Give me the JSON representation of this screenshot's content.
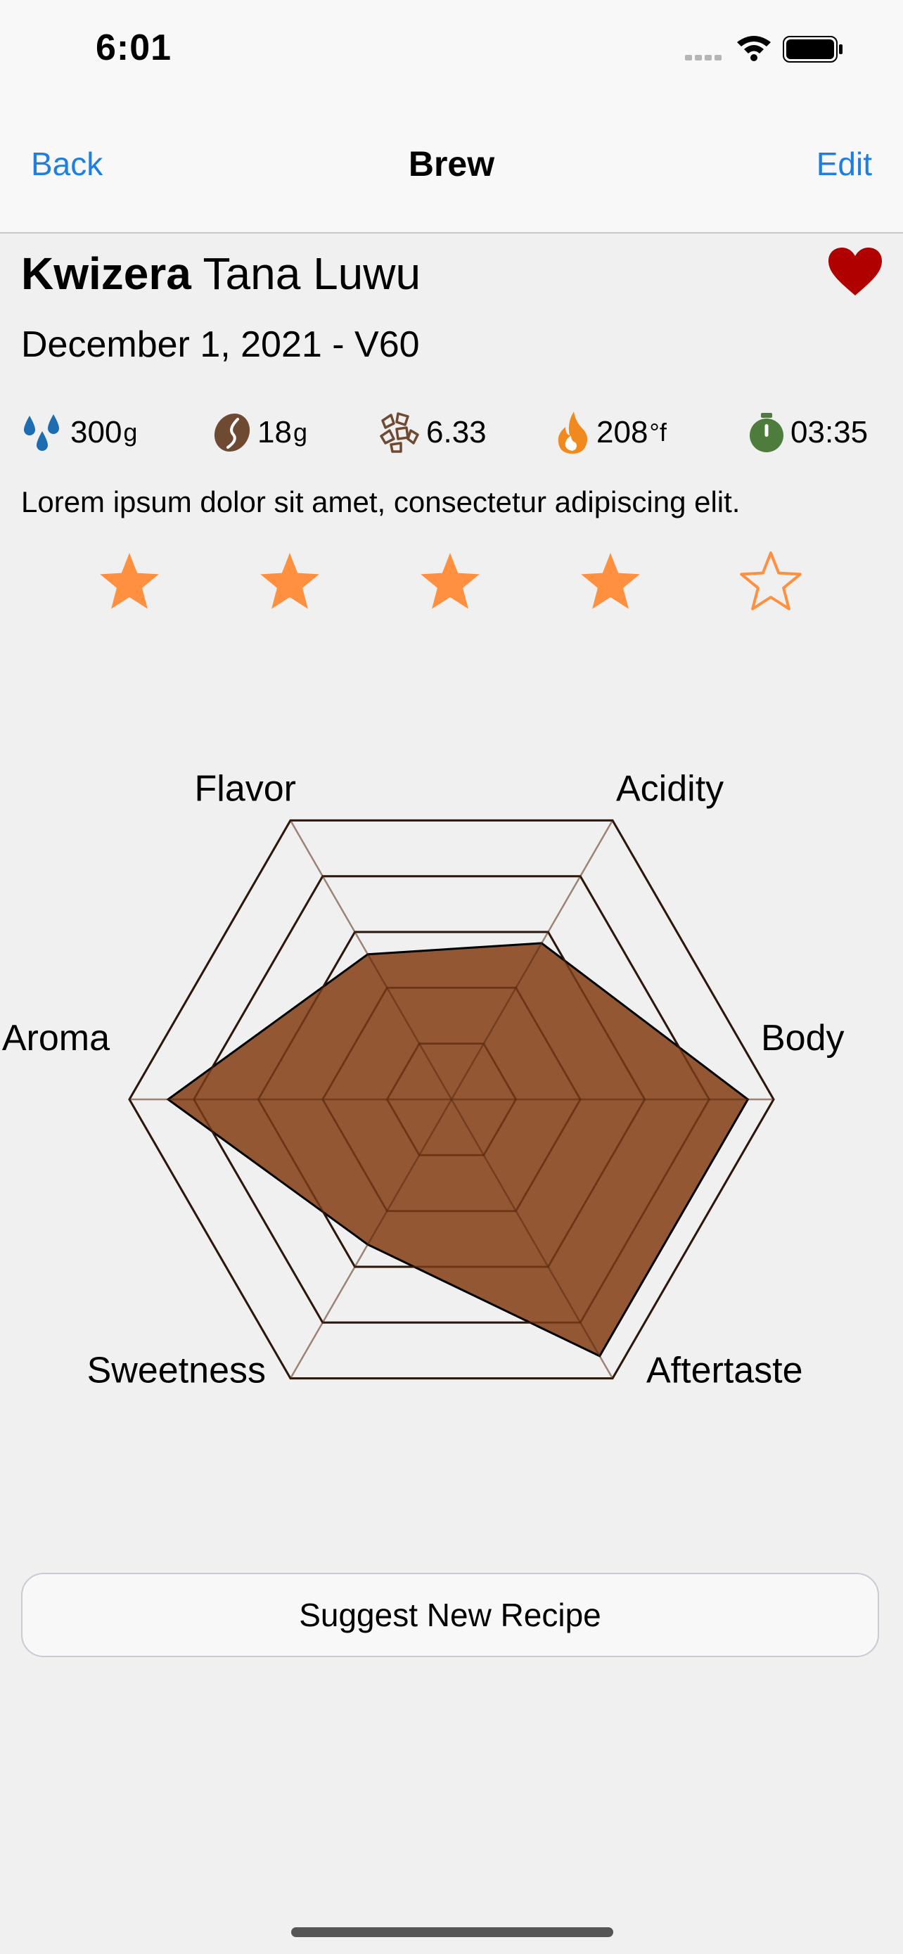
{
  "status": {
    "time": "6:01"
  },
  "nav": {
    "back_label": "Back",
    "title": "Brew",
    "edit_label": "Edit"
  },
  "brew": {
    "roaster": "Kwizera",
    "coffee_name": "Tana Luwu",
    "date_method": "December 1, 2021 - V60",
    "favorite": true,
    "notes": "Lorem ipsum dolor sit amet, consectetur adipiscing elit."
  },
  "stats": {
    "water": {
      "value": "300",
      "unit": "g",
      "icon": "water-drops-icon"
    },
    "coffee": {
      "value": "18",
      "unit": "g",
      "icon": "coffee-bean-icon"
    },
    "grind": {
      "value": "6.33",
      "unit": "",
      "icon": "grind-icon"
    },
    "temperature": {
      "value": "208",
      "unit": "°f",
      "icon": "flame-icon"
    },
    "time": {
      "value": "03:35",
      "unit": "",
      "icon": "timer-icon"
    }
  },
  "rating": {
    "value": 4,
    "max": 5
  },
  "chart_data": {
    "type": "radar",
    "categories": [
      "Acidity",
      "Body",
      "Aftertaste",
      "Sweetness",
      "Aroma",
      "Flavor"
    ],
    "values": [
      2.8,
      4.6,
      4.6,
      2.6,
      4.4,
      2.6
    ],
    "max": 5
  },
  "colors": {
    "accent": "#1f7fe0",
    "star": "#ff9040",
    "heart": "#b00000",
    "radar_fill": "#8b4a24",
    "water_icon": "#1d6db3",
    "bean_icon": "#6e4a33",
    "flame_icon": "#f08a1e",
    "timer_icon": "#4e7c3d"
  },
  "actions": {
    "suggest_label": "Suggest New Recipe"
  }
}
